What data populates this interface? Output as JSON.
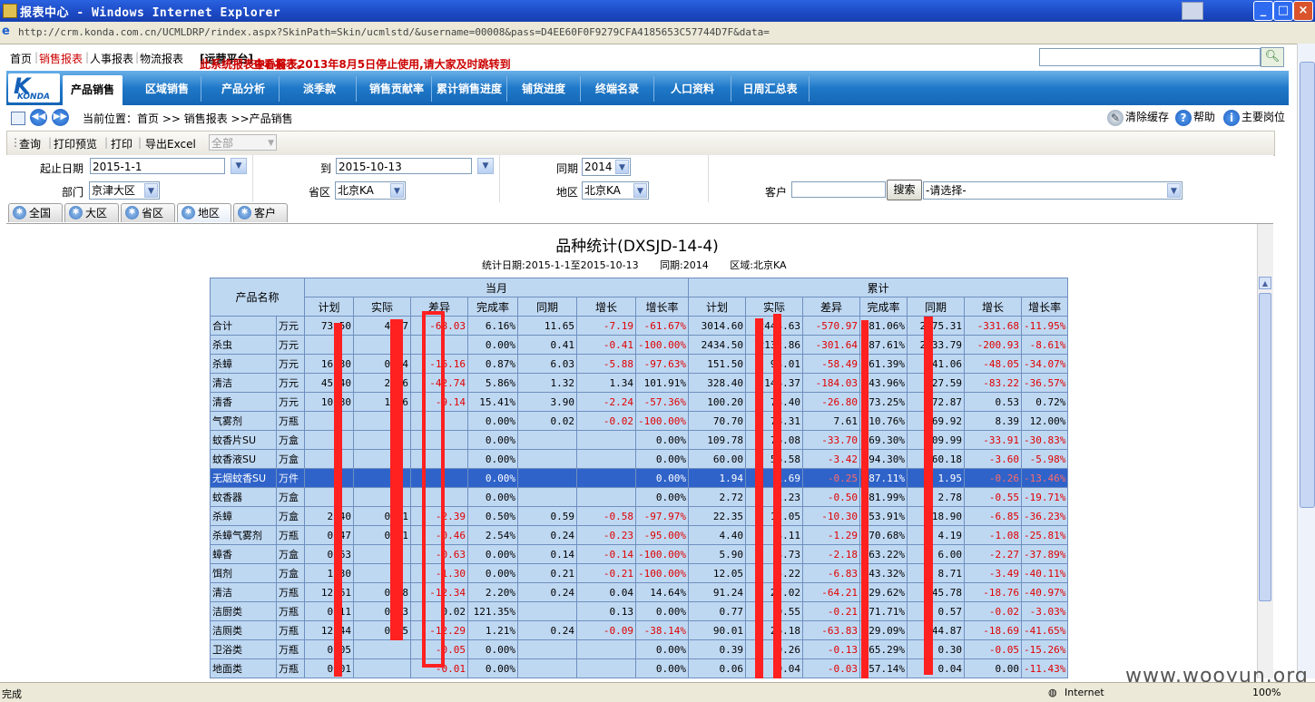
{
  "window": {
    "title": "报表中心 - Windows Internet Explorer",
    "url": "http://crm.konda.com.cn/UCMLDRP/rindex.aspx?SkinPath=Skin/ucmlstd/&username=00008&pass=D4EE60F0F9279CFA4185653C57744D7F&data="
  },
  "topnav": {
    "links": [
      "首页",
      "销售报表",
      "人事报表",
      "物流报表"
    ],
    "notice_a": "此系统报表中心将于2013年8月5日停止使用,请大家及时跳转到",
    "notice_b": "[运营平台]",
    "notice_c": "查看报表。"
  },
  "logo": {
    "text": "KONDA"
  },
  "menu": [
    "产品销售",
    "区域销售",
    "产品分析",
    "淡季款",
    "销售贡献率",
    "累计销售进度",
    "铺货进度",
    "终端名录",
    "人口资料",
    "日周汇总表"
  ],
  "location": {
    "text": "当前位置：首页 >> 销售报表 >>产品销售",
    "clear_cache": "清除缓存",
    "help": "帮助",
    "home": "主要岗位"
  },
  "toolbar": {
    "query": "查询",
    "print_preview": "打印预览",
    "print": "打印",
    "export_excel": "导出Excel",
    "scope_select": "全部"
  },
  "filters": {
    "start_label": "起止日期",
    "start_value": "2015-1-1",
    "to_label": "到",
    "to_value": "2015-10-13",
    "same_period_label": "同期",
    "same_period_value": "2014",
    "dept_label": "部门",
    "dept_value": "京津大区",
    "province_label": "省区",
    "province_value": "北京KA",
    "area_label": "地区",
    "area_value": "北京KA",
    "customer_label": "客户",
    "customer_value": "",
    "search_button": "搜索",
    "customer_select": "-请选择-"
  },
  "tabs": [
    "全国",
    "大区",
    "省区",
    "地区",
    "客户"
  ],
  "report": {
    "title": "品种统计(DXSJD-14-4)",
    "stat_date": "统计日期:2015-1-1至2015-10-13",
    "same_period": "同期:2014",
    "region": "区域:北京KA",
    "h_product": "产品名称",
    "h_current": "当月",
    "h_cumulative": "累计",
    "sub_headers": [
      "计划",
      "实际",
      "差异",
      "完成率",
      "同期",
      "增长",
      "增长率",
      "计划",
      "实际",
      "差异",
      "完成率",
      "同期",
      "增长",
      "增长率"
    ],
    "rows": [
      [
        "合计",
        "万元",
        "73.50",
        "4.47",
        "-68.03",
        "6.16%",
        "11.65",
        "-7.19",
        "-61.67%",
        "3014.60",
        "2443.63",
        "-570.97",
        "81.06%",
        "2775.31",
        "-331.68",
        "-11.95%"
      ],
      [
        "杀虫",
        "万元",
        "",
        "",
        "",
        "0.00%",
        "0.41",
        "-0.41",
        "-100.00%",
        "2434.50",
        "2132.86",
        "-301.64",
        "87.61%",
        "2333.79",
        "-200.93",
        "-8.61%"
      ],
      [
        "杀蟑",
        "万元",
        "16.30",
        "0.14",
        "-16.16",
        "0.87%",
        "6.03",
        "-5.88",
        "-97.63%",
        "151.50",
        "93.01",
        "-58.49",
        "61.39%",
        "141.06",
        "-48.05",
        "-34.07%"
      ],
      [
        "清洁",
        "万元",
        "45.40",
        "2.66",
        "-42.74",
        "5.86%",
        "1.32",
        "1.34",
        "101.91%",
        "328.40",
        "144.37",
        "-184.03",
        "43.96%",
        "227.59",
        "-83.22",
        "-36.57%"
      ],
      [
        "清香",
        "万元",
        "10.80",
        "1.66",
        "-9.14",
        "15.41%",
        "3.90",
        "-2.24",
        "-57.36%",
        "100.20",
        "73.40",
        "-26.80",
        "73.25%",
        "72.87",
        "0.53",
        "0.72%"
      ],
      [
        "气雾剂",
        "万瓶",
        "",
        "",
        "",
        "0.00%",
        "0.02",
        "-0.02",
        "-100.00%",
        "70.70",
        "78.31",
        "7.61",
        "110.76%",
        "69.92",
        "8.39",
        "12.00%"
      ],
      [
        "蚊香片SU",
        "万盒",
        "",
        "",
        "",
        "0.00%",
        "",
        "",
        "0.00%",
        "109.78",
        "76.08",
        "-33.70",
        "69.30%",
        "109.99",
        "-33.91",
        "-30.83%"
      ],
      [
        "蚊香液SU",
        "万盒",
        "",
        "",
        "",
        "0.00%",
        "",
        "",
        "0.00%",
        "60.00",
        "56.58",
        "-3.42",
        "94.30%",
        "60.18",
        "-3.60",
        "-5.98%"
      ],
      [
        "无烟蚊香SU",
        "万件",
        "",
        "",
        "",
        "0.00%",
        "",
        "",
        "0.00%",
        "1.94",
        "1.69",
        "-0.25",
        "87.11%",
        "1.95",
        "-0.26",
        "-13.46%"
      ],
      [
        "蚊香器",
        "万盒",
        "",
        "",
        "",
        "0.00%",
        "",
        "",
        "0.00%",
        "2.72",
        "2.23",
        "-0.50",
        "81.99%",
        "2.78",
        "-0.55",
        "-19.71%"
      ],
      [
        "杀蟑",
        "万盒",
        "2.40",
        "0.01",
        "-2.39",
        "0.50%",
        "0.59",
        "-0.58",
        "-97.97%",
        "22.35",
        "12.05",
        "-10.30",
        "53.91%",
        "18.90",
        "-6.85",
        "-36.23%"
      ],
      [
        "杀蟑气雾剂",
        "万瓶",
        "0.47",
        "0.01",
        "-0.46",
        "2.54%",
        "0.24",
        "-0.23",
        "-95.00%",
        "4.40",
        "3.11",
        "-1.29",
        "70.68%",
        "4.19",
        "-1.08",
        "-25.81%"
      ],
      [
        "蟑香",
        "万盒",
        "0.63",
        "",
        "-0.63",
        "0.00%",
        "0.14",
        "-0.14",
        "-100.00%",
        "5.90",
        "3.73",
        "-2.18",
        "63.22%",
        "6.00",
        "-2.27",
        "-37.89%"
      ],
      [
        "饵剂",
        "万盒",
        "1.30",
        "",
        "-1.30",
        "0.00%",
        "0.21",
        "-0.21",
        "-100.00%",
        "12.05",
        "5.22",
        "-6.83",
        "43.32%",
        "8.71",
        "-3.49",
        "-40.11%"
      ],
      [
        "清洁",
        "万瓶",
        "12.61",
        "0.28",
        "-12.34",
        "2.20%",
        "0.24",
        "0.04",
        "14.64%",
        "91.24",
        "27.02",
        "-64.21",
        "29.62%",
        "45.78",
        "-18.76",
        "-40.97%"
      ],
      [
        "洁厨类",
        "万瓶",
        "0.11",
        "0.13",
        "0.02",
        "121.35%",
        "",
        "0.13",
        "0.00%",
        "0.77",
        "0.55",
        "-0.21",
        "71.71%",
        "0.57",
        "-0.02",
        "-3.03%"
      ],
      [
        "洁厕类",
        "万瓶",
        "12.44",
        "0.15",
        "-12.29",
        "1.21%",
        "0.24",
        "-0.09",
        "-38.14%",
        "90.01",
        "26.18",
        "-63.83",
        "29.09%",
        "44.87",
        "-18.69",
        "-41.65%"
      ],
      [
        "卫浴类",
        "万瓶",
        "0.05",
        "",
        "-0.05",
        "0.00%",
        "",
        "",
        "0.00%",
        "0.39",
        "0.26",
        "-0.13",
        "65.29%",
        "0.30",
        "-0.05",
        "-15.26%"
      ],
      [
        "地面类",
        "万瓶",
        "0.01",
        "",
        "-0.01",
        "0.00%",
        "",
        "",
        "0.00%",
        "0.06",
        "0.04",
        "-0.03",
        "57.14%",
        "0.04",
        "0.00",
        "-11.43%"
      ]
    ]
  },
  "status": {
    "left": "完成",
    "zone": "Internet",
    "zoom": "100%"
  },
  "watermark": "www.wooyun.org"
}
